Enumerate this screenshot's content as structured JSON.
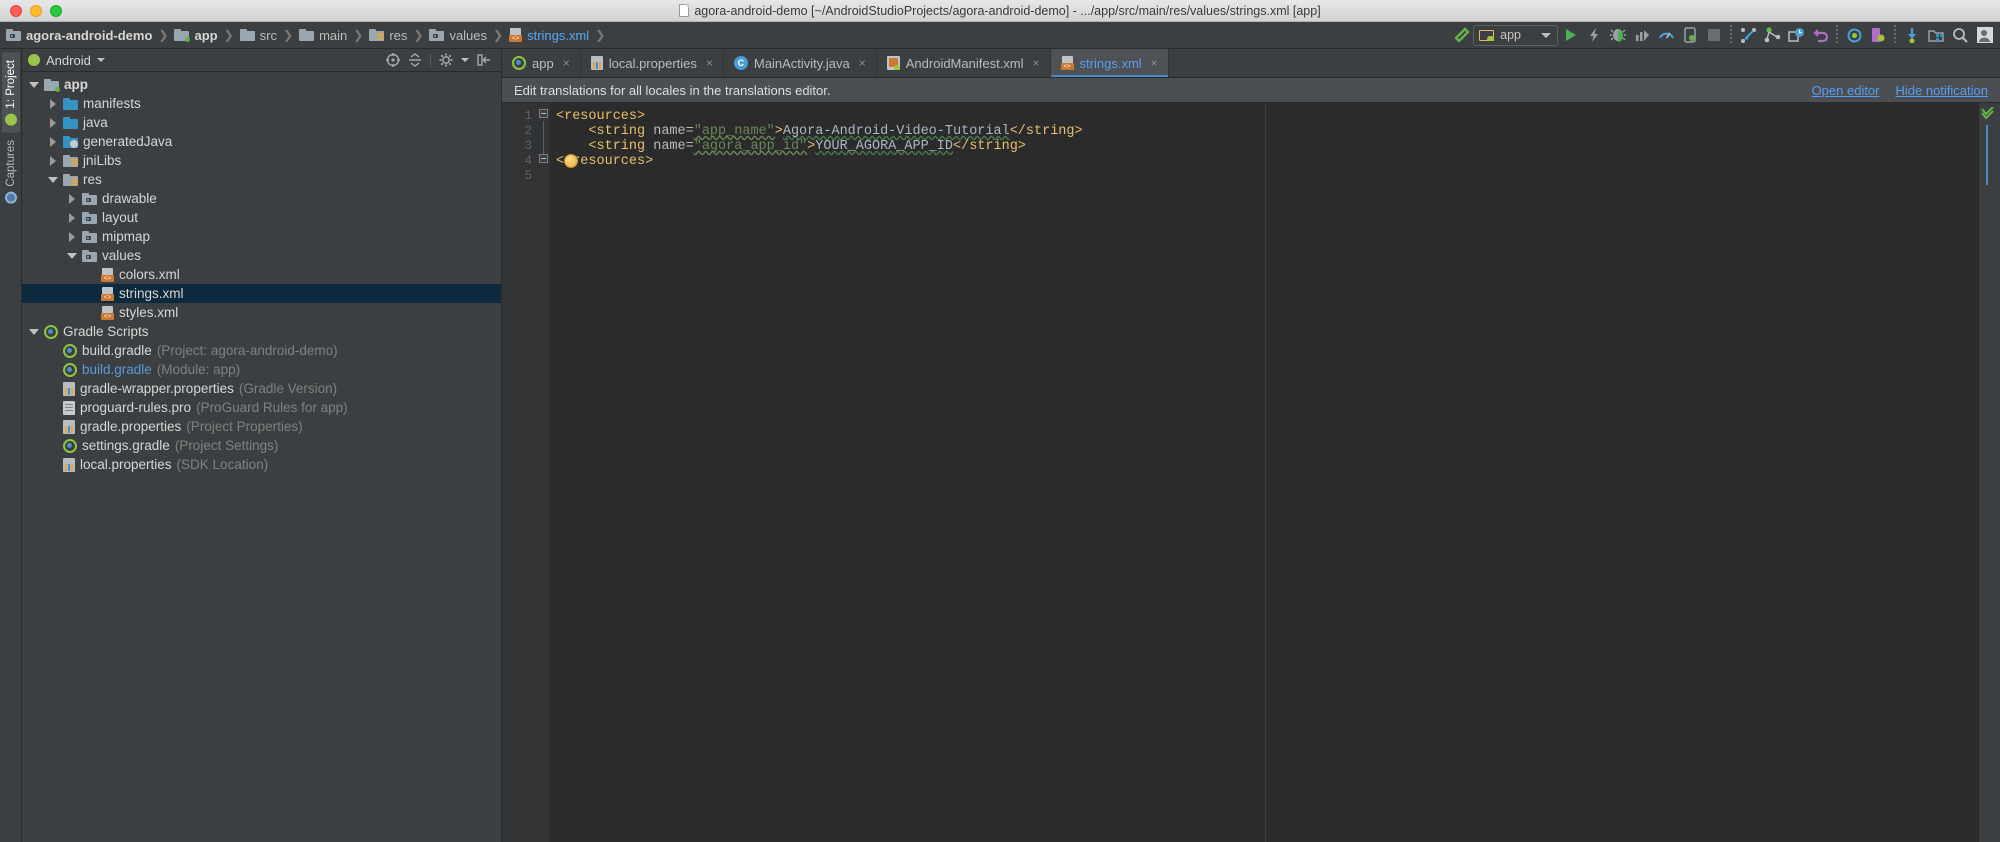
{
  "window": {
    "title": "agora-android-demo [~/AndroidStudioProjects/agora-android-demo] - .../app/src/main/res/values/strings.xml [app]",
    "doc_icon": "document-icon",
    "traffic_lights": [
      "close-button",
      "minimize-button",
      "maximize-button"
    ]
  },
  "breadcrumbs": [
    {
      "label": "agora-android-demo",
      "icon": "project-folder-icon"
    },
    {
      "label": "app",
      "icon": "module-folder-icon"
    },
    {
      "label": "src",
      "icon": "folder-icon"
    },
    {
      "label": "main",
      "icon": "folder-icon"
    },
    {
      "label": "res",
      "icon": "res-folder-icon"
    },
    {
      "label": "values",
      "icon": "values-folder-icon"
    },
    {
      "label": "strings.xml",
      "icon": "xml-file-icon"
    }
  ],
  "toolbar": {
    "build_icon": "hammer-icon",
    "module_selector": {
      "label": "app",
      "icon": "android-module-icon",
      "arrow": "chevron-down-icon"
    },
    "run_icon": "run-play-icon",
    "apply_changes_icon": "lightning-icon",
    "debug_icon": "debug-bug-icon",
    "profile_icon": "profiler-bars-icon",
    "monitor_icon": "gauge-icon",
    "device_icon": "device-manager-icon",
    "stop_icon": "stop-square-icon",
    "step_icon": "step-into-icon",
    "vcs_icon": "vcs-branch-icon",
    "history_icon": "history-clock-icon",
    "undo_icon": "undo-arrow-icon",
    "sync_icon": "gradle-sync-icon",
    "avd_icon": "avd-manager-icon",
    "sdk_icon": "sdk-download-icon",
    "layout_icon": "project-structure-icon",
    "search_icon": "search-everywhere-icon",
    "profile_avatar_icon": "user-avatar-icon"
  },
  "left_strip": {
    "tabs": [
      {
        "label": "1: Project",
        "icon": "android-robot-icon",
        "active": true
      },
      {
        "label": "Captures",
        "icon": "captures-icon",
        "active": false
      }
    ]
  },
  "project_panel": {
    "title": "Android",
    "dropdown_icon": "chevron-down-icon",
    "panel_icons": [
      "locate-target-icon",
      "collapse-all-icon",
      "settings-gear-icon",
      "hide-panel-icon"
    ],
    "tree": [
      {
        "indent": 0,
        "arrow": "open",
        "icon": "module-folder-icon",
        "label": "app",
        "bold": true,
        "hint": ""
      },
      {
        "indent": 1,
        "arrow": "closed",
        "icon": "folder-teal-icon",
        "label": "manifests",
        "bold": false,
        "hint": ""
      },
      {
        "indent": 1,
        "arrow": "closed",
        "icon": "folder-teal-icon",
        "label": "java",
        "bold": false,
        "hint": ""
      },
      {
        "indent": 1,
        "arrow": "closed",
        "icon": "generated-folder-icon",
        "label": "generatedJava",
        "bold": false,
        "hint": ""
      },
      {
        "indent": 1,
        "arrow": "closed",
        "icon": "res-folder-icon",
        "label": "jniLibs",
        "bold": false,
        "hint": ""
      },
      {
        "indent": 1,
        "arrow": "open",
        "icon": "res-folder-icon",
        "label": "res",
        "bold": false,
        "hint": ""
      },
      {
        "indent": 2,
        "arrow": "closed",
        "icon": "values-folder-icon",
        "label": "drawable",
        "bold": false,
        "hint": ""
      },
      {
        "indent": 2,
        "arrow": "closed",
        "icon": "values-folder-icon",
        "label": "layout",
        "bold": false,
        "hint": ""
      },
      {
        "indent": 2,
        "arrow": "closed",
        "icon": "values-folder-icon",
        "label": "mipmap",
        "bold": false,
        "hint": ""
      },
      {
        "indent": 2,
        "arrow": "open",
        "icon": "values-folder-icon",
        "label": "values",
        "bold": false,
        "hint": ""
      },
      {
        "indent": 3,
        "arrow": "none",
        "icon": "xml-file-icon",
        "label": "colors.xml",
        "bold": false,
        "hint": ""
      },
      {
        "indent": 3,
        "arrow": "none",
        "icon": "xml-file-icon",
        "label": "strings.xml",
        "bold": false,
        "hint": "",
        "selected": true
      },
      {
        "indent": 3,
        "arrow": "none",
        "icon": "xml-file-icon",
        "label": "styles.xml",
        "bold": false,
        "hint": ""
      },
      {
        "indent": 0,
        "arrow": "open",
        "icon": "gradle-icon",
        "label": "Gradle Scripts",
        "bold": false,
        "hint": ""
      },
      {
        "indent": 1,
        "arrow": "none",
        "icon": "gradle-icon",
        "label": "build.gradle",
        "bold": false,
        "hint": "(Project: agora-android-demo)"
      },
      {
        "indent": 1,
        "arrow": "none",
        "icon": "gradle-icon",
        "label": "build.gradle",
        "bold": false,
        "hint": "(Module: app)",
        "link": true
      },
      {
        "indent": 1,
        "arrow": "none",
        "icon": "properties-icon",
        "label": "gradle-wrapper.properties",
        "bold": false,
        "hint": "(Gradle Version)"
      },
      {
        "indent": 1,
        "arrow": "none",
        "icon": "proguard-icon",
        "label": "proguard-rules.pro",
        "bold": false,
        "hint": "(ProGuard Rules for app)"
      },
      {
        "indent": 1,
        "arrow": "none",
        "icon": "properties-icon",
        "label": "gradle.properties",
        "bold": false,
        "hint": "(Project Properties)"
      },
      {
        "indent": 1,
        "arrow": "none",
        "icon": "gradle-icon",
        "label": "settings.gradle",
        "bold": false,
        "hint": "(Project Settings)"
      },
      {
        "indent": 1,
        "arrow": "none",
        "icon": "properties-icon",
        "label": "local.properties",
        "bold": false,
        "hint": "(SDK Location)"
      }
    ]
  },
  "editor": {
    "tabs": [
      {
        "label": "app",
        "icon": "gradle-icon",
        "active": false
      },
      {
        "label": "local.properties",
        "icon": "properties-icon",
        "active": false
      },
      {
        "label": "MainActivity.java",
        "icon": "java-class-icon",
        "active": false
      },
      {
        "label": "AndroidManifest.xml",
        "icon": "manifest-icon",
        "active": false
      },
      {
        "label": "strings.xml",
        "icon": "xml-file-icon",
        "active": true
      }
    ],
    "close_glyph": "×",
    "notification": {
      "message": "Edit translations for all locales in the translations editor.",
      "open_editor_label": "Open editor",
      "hide_label": "Hide notification"
    },
    "line_numbers": [
      "1",
      "2",
      "3",
      "4",
      "5"
    ],
    "code_lines": [
      {
        "n": 1,
        "segments": [
          {
            "t": "<resources>",
            "c": "tag"
          }
        ]
      },
      {
        "n": 2,
        "segments": [
          {
            "t": "    <string ",
            "c": "tag"
          },
          {
            "t": "name=",
            "c": "attr"
          },
          {
            "t": "\"app_name\"",
            "c": "value-squig"
          },
          {
            "t": ">",
            "c": "tag"
          },
          {
            "t": "Agora-Android-Video-Tutorial",
            "c": "text-squig"
          },
          {
            "t": "</string>",
            "c": "tag"
          }
        ]
      },
      {
        "n": 3,
        "segments": [
          {
            "t": "    <string ",
            "c": "tag"
          },
          {
            "t": "name=",
            "c": "attr"
          },
          {
            "t": "\"agora_app_id\"",
            "c": "value-squig"
          },
          {
            "t": ">",
            "c": "tag"
          },
          {
            "t": "YOUR_AGORA_APP_ID",
            "c": "text-squig"
          },
          {
            "t": "</string>",
            "c": "tag"
          }
        ]
      },
      {
        "n": 4,
        "segments": [
          {
            "t": "</resources>",
            "c": "tag"
          }
        ]
      },
      {
        "n": 5,
        "segments": []
      }
    ],
    "inspection": {
      "status_icon": "inspections-ok-checkmark",
      "color": "#62b543"
    },
    "intention_bulb_icon": "intention-lightbulb-icon",
    "raw_text": "<resources>\n    <string name=\"app_name\">Agora-Android-Video-Tutorial</string>\n    <string name=\"agora_app_id\">YOUR_AGORA_APP_ID</string>\n</resources>"
  },
  "colors": {
    "chrome": "#3c3f41",
    "editor_bg": "#2b2b2b",
    "gutter_bg": "#313335",
    "selection": "#0d293e",
    "link": "#589df6",
    "tag": "#e8bf6a",
    "attr_value": "#6a8759",
    "text": "#a9b7c6",
    "accent_green": "#62b543"
  }
}
